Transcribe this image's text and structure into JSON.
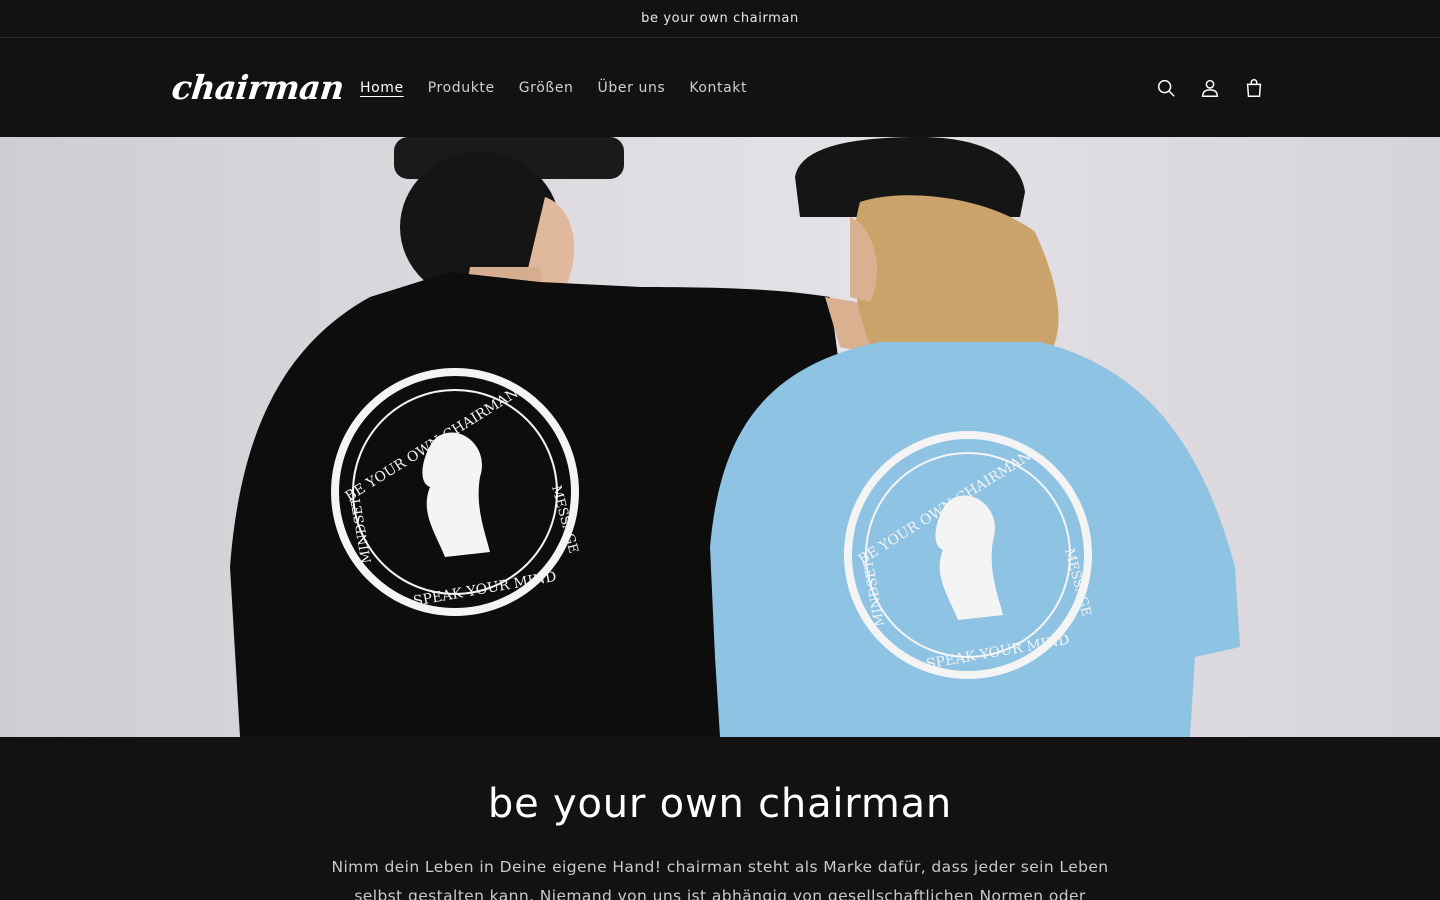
{
  "announcement": {
    "text": "be your own chairman"
  },
  "header": {
    "logo": "chairman",
    "nav": [
      {
        "label": "Home",
        "active": true
      },
      {
        "label": "Produkte",
        "active": false
      },
      {
        "label": "Größen",
        "active": false
      },
      {
        "label": "Über uns",
        "active": false
      },
      {
        "label": "Kontakt",
        "active": false
      }
    ],
    "icons": [
      "search-icon",
      "account-icon",
      "cart-icon"
    ]
  },
  "hero": {
    "shirt_print": {
      "top_arc": "BE YOUR OWN CHAIRMAN",
      "right_text": "MESSAGE",
      "left_text": "MINDSET",
      "bottom_arc": "SPEAK YOUR MIND"
    },
    "colors": {
      "shirt_left": "#0d0d0d",
      "shirt_right": "#8ec3e3",
      "wall": "#dcdade"
    }
  },
  "main": {
    "heading": "be your own chairman",
    "text": "Nimm dein Leben in Deine eigene Hand! chairman steht als Marke dafür, dass jeder sein Leben selbst gestalten kann. Niemand von uns ist abhängig von gesellschaftlichen Normen oder Zwängen. Du möchtest"
  }
}
